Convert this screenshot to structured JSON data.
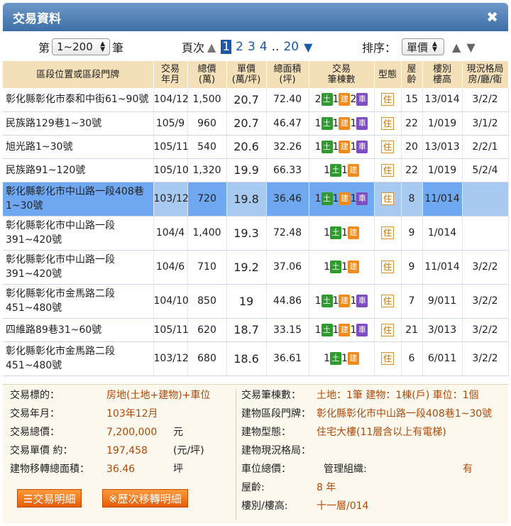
{
  "window": {
    "title": "交易資料",
    "close": "✖"
  },
  "toolbar": {
    "range_prefix": "第",
    "range_value": "1~200",
    "range_suffix": "筆",
    "page_label": "頁次",
    "pages": [
      "1",
      "2",
      "3",
      "4",
      "..",
      "20"
    ],
    "current_page": "1",
    "sort_label": "排序：",
    "sort_value": "單價"
  },
  "table": {
    "headers": [
      "區段位置或區段門牌",
      "交易\n年月",
      "總價\n(萬)",
      "單價\n(萬/坪)",
      "總面積\n(坪)",
      "交易\n筆棟數",
      "型態",
      "屋\n齡",
      "樓別\n樓高",
      "現況格局\n房/廳/衛"
    ],
    "badge_labels": {
      "land": "土",
      "build": "建",
      "car": "車"
    },
    "type_label": "住",
    "rows": [
      {
        "addr": "彰化縣彰化市泰和中街61~90號",
        "ym": "104/12",
        "total": "1,500",
        "unit": "20.7",
        "area": "72.40",
        "land": "2",
        "build": "1",
        "car": "2",
        "age": "15",
        "floor": "13/014",
        "layout": "3/2/2"
      },
      {
        "addr": "民族路129巷1~30號",
        "ym": "105/9",
        "total": "960",
        "unit": "20.7",
        "area": "46.47",
        "land": "1",
        "build": "1",
        "car": "1",
        "age": "22",
        "floor": "1/019",
        "layout": "3/1/2"
      },
      {
        "addr": "旭光路1~30號",
        "ym": "105/11",
        "total": "540",
        "unit": "20.6",
        "area": "32.26",
        "land": "1",
        "build": "1",
        "car": "1",
        "age": "20",
        "floor": "13/013",
        "layout": "2/2/1"
      },
      {
        "addr": "民族路91~120號",
        "ym": "105/10",
        "total": "1,320",
        "unit": "19.9",
        "area": "66.33",
        "land": "1",
        "build": "1",
        "car": "",
        "age": "22",
        "floor": "1/019",
        "layout": "5/2/4"
      },
      {
        "addr": "彰化縣彰化市中山路一段408巷1~30號",
        "ym": "103/12",
        "total": "720",
        "unit": "19.8",
        "area": "36.46",
        "land": "1",
        "build": "1",
        "car": "1",
        "age": "8",
        "floor": "11/014",
        "layout": "",
        "selected": true,
        "tall": true
      },
      {
        "addr": "彰化縣彰化市中山路一段391~420號",
        "ym": "104/4",
        "total": "1,400",
        "unit": "19.3",
        "area": "72.48",
        "land": "1",
        "build": "1",
        "car": "",
        "age": "9",
        "floor": "1/014",
        "layout": "",
        "tall": true
      },
      {
        "addr": "彰化縣彰化市中山路一段391~420號",
        "ym": "104/6",
        "total": "710",
        "unit": "19.2",
        "area": "37.06",
        "land": "1",
        "build": "1",
        "car": "",
        "age": "9",
        "floor": "11/014",
        "layout": "3/2/2",
        "tall": true
      },
      {
        "addr": "彰化縣彰化市金馬路二段451~480號",
        "ym": "104/10",
        "total": "850",
        "unit": "19",
        "area": "44.86",
        "land": "1",
        "build": "1",
        "car": "1",
        "age": "7",
        "floor": "9/011",
        "layout": "3/2/2",
        "tall": true
      },
      {
        "addr": "四維路89巷31~60號",
        "ym": "105/11",
        "total": "620",
        "unit": "18.7",
        "area": "33.15",
        "land": "1",
        "build": "1",
        "car": "1",
        "age": "21",
        "floor": "3/013",
        "layout": "3/2/2"
      },
      {
        "addr": "彰化縣彰化市金馬路二段451~480號",
        "ym": "103/12",
        "total": "680",
        "unit": "18.6",
        "area": "36.61",
        "land": "1",
        "build": "1",
        "car": "",
        "age": "6",
        "floor": "6/011",
        "layout": "3/2/2",
        "tall": true
      }
    ]
  },
  "detail": {
    "target_label": "交易標的：",
    "target_value": "房地(土地+建物)+車位",
    "ym_label": "交易年月：",
    "ym_value": "103年12月",
    "total_label": "交易總價：",
    "total_value": "7,200,000",
    "total_unit": "元",
    "unit_label": "交易單價 約：",
    "unit_value": "197,458",
    "unit_unit": "(元/坪)",
    "area_label": "建物移轉總面積：",
    "area_value": "36.46",
    "area_unit": "坪",
    "count_label": "交易筆棟數：",
    "count_value": "土地：1筆 建物：1棟(戶) 車位：1個",
    "addr_label": "建物區段門牌：",
    "addr_value": "彰化縣彰化市中山路一段408巷1~30號",
    "btype_label": "建物型態：",
    "btype_value": "住宅大樓(11層含以上有電梯)",
    "layout_label": "建物現況格局：",
    "layout_value": "",
    "parking_label": "車位總價：",
    "mgmt_label": "管理組織:",
    "mgmt_value": "有",
    "age_label": "屋齡:",
    "age_value": "8 年",
    "floor_label": "樓別/樓高:",
    "floor_value": "十一層/014",
    "btn_detail": "☰交易明細",
    "btn_history": "※歷次移轉明細"
  },
  "colors": {
    "header_bg": "#f3dfb8",
    "title_bg": "#4a7bb2",
    "selected_row": "#a8c9f0",
    "accent": "#e45d0a"
  }
}
